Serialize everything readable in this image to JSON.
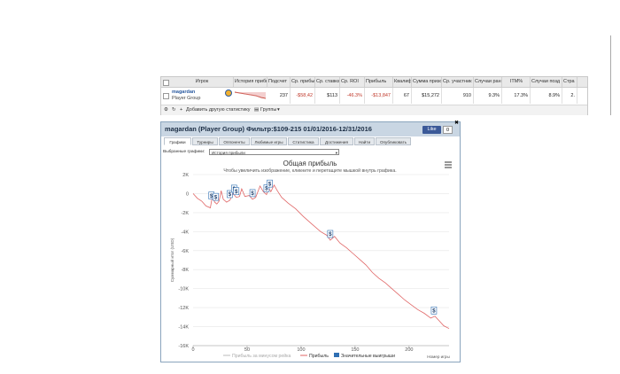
{
  "stats_table": {
    "columns": [
      "Игрок",
      "История прибыл",
      "Подсчет",
      "Ср. прибыль",
      "Ср. ставка",
      "Ср. ROI",
      "Прибыль",
      "Квалиф",
      "Сумма призо",
      "Ср. участник",
      "Случаи рани",
      "ITM%",
      "Случаи позд",
      "Стра"
    ],
    "row": {
      "player": "magardan",
      "group": "Player Group",
      "count": "237",
      "avg_profit": "-$58,42",
      "avg_stake": "$113",
      "avg_roi": "-46.3%",
      "profit": "-$13,847",
      "qualif": "67",
      "prize_sum": "$15,272",
      "avg_entrants": "910",
      "early": "9.3%",
      "itm": "17.3%",
      "late": "8.9%",
      "page": "2."
    },
    "footer_add": "Добавить другую статистику",
    "footer_groups": "Группы"
  },
  "panel": {
    "title": "magardan (Player Group) Фильтр:$109-215 01/01/2016-12/31/2016",
    "fb_like": "Like",
    "fb_count": "0",
    "tabs": [
      "Графики",
      "Турниры",
      "Оппоненты",
      "Любимые игры",
      "Статистика",
      "Достижения",
      "Найти",
      "Опубликовать"
    ],
    "chart_select_label": "Выбранные графики:",
    "chart_select_value": "История прибыли"
  },
  "chart_data": {
    "type": "line",
    "title": "Общая прибыль",
    "subtitle": "Чтобы увеличить изображение, кликните и перетащите мышкой внутрь графика.",
    "ylabel": "Суммарный итог (USD)",
    "xlabel": "Номер игры",
    "xlim": [
      0,
      237
    ],
    "ylim": [
      -16000,
      2000
    ],
    "x_ticks": [
      "0",
      "50",
      "100",
      "150",
      "200"
    ],
    "y_ticks": [
      "2K",
      "0",
      "-2K",
      "-4K",
      "-6K",
      "-8K",
      "-10K",
      "-12K",
      "-14K",
      "-16K"
    ],
    "legend": [
      "Прибыль за минусом рейка",
      "Прибыль",
      "Значительные выигрыши"
    ],
    "colors": {
      "profit": "#e06666",
      "rake": "#bbbbbb",
      "big_win": "#2f6fb3"
    },
    "series": [
      {
        "name": "Прибыль",
        "points": [
          [
            0,
            0
          ],
          [
            4,
            -500
          ],
          [
            8,
            -800
          ],
          [
            12,
            -1300
          ],
          [
            16,
            -1500
          ],
          [
            18,
            -200
          ],
          [
            20,
            -900
          ],
          [
            22,
            -1100
          ],
          [
            24,
            -800
          ],
          [
            26,
            300
          ],
          [
            28,
            -600
          ],
          [
            31,
            -900
          ],
          [
            34,
            -700
          ],
          [
            37,
            0
          ],
          [
            40,
            -400
          ],
          [
            43,
            -300
          ],
          [
            45,
            500
          ],
          [
            48,
            -300
          ],
          [
            52,
            -200
          ],
          [
            55,
            -600
          ],
          [
            58,
            -400
          ],
          [
            62,
            800
          ],
          [
            65,
            200
          ],
          [
            68,
            -100
          ],
          [
            70,
            600
          ],
          [
            72,
            200
          ],
          [
            75,
            900
          ],
          [
            78,
            300
          ],
          [
            82,
            -400
          ],
          [
            88,
            -1000
          ],
          [
            95,
            -1600
          ],
          [
            102,
            -2400
          ],
          [
            110,
            -3200
          ],
          [
            118,
            -4000
          ],
          [
            124,
            -4400
          ],
          [
            127,
            -4900
          ],
          [
            131,
            -4500
          ],
          [
            136,
            -5200
          ],
          [
            142,
            -5700
          ],
          [
            148,
            -6300
          ],
          [
            154,
            -6900
          ],
          [
            160,
            -7500
          ],
          [
            166,
            -8300
          ],
          [
            172,
            -8900
          ],
          [
            178,
            -9400
          ],
          [
            184,
            -10000
          ],
          [
            190,
            -10600
          ],
          [
            196,
            -11200
          ],
          [
            202,
            -11700
          ],
          [
            208,
            -12200
          ],
          [
            214,
            -12600
          ],
          [
            220,
            -13100
          ],
          [
            224,
            -12900
          ],
          [
            228,
            -13400
          ],
          [
            232,
            -13900
          ],
          [
            237,
            -14200
          ]
        ]
      }
    ],
    "big_wins_x": [
      17,
      21,
      34,
      38,
      40,
      55,
      68,
      71,
      127,
      223
    ]
  }
}
